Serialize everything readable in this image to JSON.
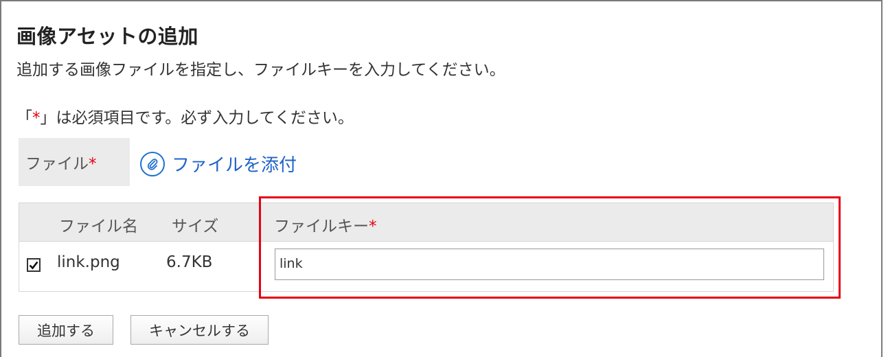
{
  "dialog": {
    "title": "画像アセットの追加",
    "description": "追加する画像ファイルを指定し、ファイルキーを入力してください。"
  },
  "required_note": {
    "prefix": "「",
    "mark": "*",
    "suffix": "」は必須項目です。必ず入力してください。"
  },
  "file_field": {
    "label": "ファイル",
    "required_mark": "*",
    "attach_link": "ファイルを添付",
    "attach_icon": "paperclip-icon"
  },
  "file_table": {
    "headers": {
      "file_name": "ファイル名",
      "size": "サイズ",
      "file_key": "ファイルキー",
      "file_key_required_mark": "*"
    },
    "rows": [
      {
        "checked": true,
        "file_name": "link.png",
        "size": "6.7KB",
        "file_key": "link"
      }
    ]
  },
  "buttons": {
    "add": "追加する",
    "cancel": "キャンセルする"
  },
  "colors": {
    "required": "#e60012",
    "link": "#1f62c9",
    "highlight": "#e60012",
    "header_bg": "#ebebeb"
  }
}
